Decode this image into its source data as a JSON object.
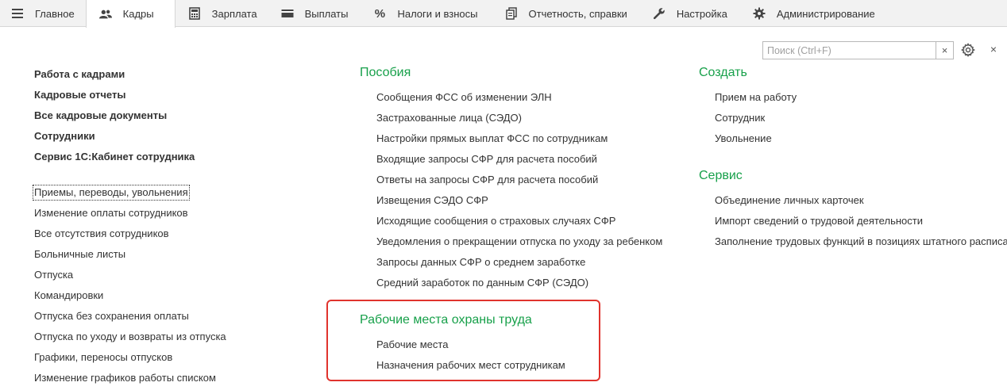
{
  "nav": {
    "tabs": [
      {
        "label": "Главное",
        "icon": "menu-icon"
      },
      {
        "label": "Кадры",
        "icon": "people-icon"
      },
      {
        "label": "Зарплата",
        "icon": "calculator-icon"
      },
      {
        "label": "Выплаты",
        "icon": "wallet-icon"
      },
      {
        "label": "Налоги и взносы",
        "icon": "percent-icon"
      },
      {
        "label": "Отчетность, справки",
        "icon": "documents-icon"
      },
      {
        "label": "Настройка",
        "icon": "wrench-icon"
      },
      {
        "label": "Администрирование",
        "icon": "gear-icon"
      }
    ],
    "active": "Кадры"
  },
  "search": {
    "placeholder": "Поиск (Ctrl+F)",
    "value": "",
    "clear_label": "×"
  },
  "close_label": "×",
  "left": {
    "bold_links": [
      "Работа с кадрами",
      "Кадровые отчеты",
      "Все кадровые документы",
      "Сотрудники",
      "Сервис 1С:Кабинет сотрудника"
    ],
    "links": [
      "Приемы, переводы, увольнения",
      "Изменение оплаты сотрудников",
      "Все отсутствия сотрудников",
      "Больничные листы",
      "Отпуска",
      "Командировки",
      "Отпуска без сохранения оплаты",
      "Отпуска по уходу и возвраты из отпуска",
      "Графики, переносы отпусков",
      "Изменение графиков работы списком"
    ]
  },
  "middle": {
    "benefits": {
      "title": "Пособия",
      "items": [
        "Сообщения ФСС об изменении ЭЛН",
        "Застрахованные лица (СЭДО)",
        "Настройки прямых выплат ФСС по сотрудникам",
        "Входящие запросы СФР для расчета пособий",
        "Ответы на запросы СФР для расчета пособий",
        "Извещения СЭДО СФР",
        "Исходящие сообщения о страховых случаях СФР",
        "Уведомления о прекращении отпуска по уходу за ребенком",
        "Запросы данных СФР о среднем заработке",
        "Средний заработок по данным СФР (СЭДО)"
      ]
    },
    "workplaces": {
      "title": "Рабочие места охраны труда",
      "items": [
        "Рабочие места",
        "Назначения рабочих мест сотрудникам"
      ]
    }
  },
  "right": {
    "create": {
      "title": "Создать",
      "items": [
        "Прием на работу",
        "Сотрудник",
        "Увольнение"
      ]
    },
    "service": {
      "title": "Сервис",
      "items": [
        "Объединение личных карточек",
        "Импорт сведений о трудовой деятельности",
        "Заполнение трудовых функций в позициях штатного расписа"
      ]
    }
  },
  "colors": {
    "group_title": "#17a04a",
    "highlight": "#e0332d"
  }
}
